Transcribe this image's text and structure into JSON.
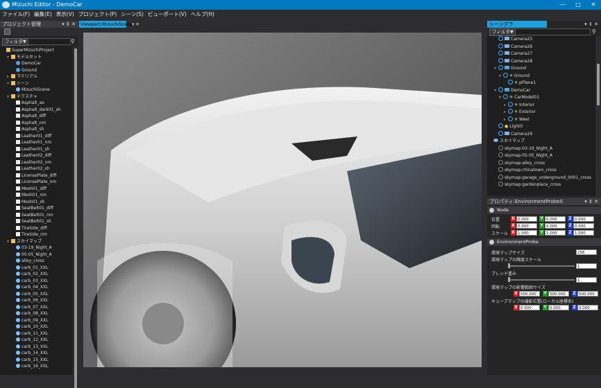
{
  "window": {
    "title": "Mizuchi Editor - DemoCar",
    "min": "—",
    "max": "□",
    "close": "✕"
  },
  "menu": [
    "ファイル(F)",
    "編集(E)",
    "表示(V)",
    "プロジェクト(P)",
    "シーン(S)",
    "ビューポート(V)",
    "ヘルプ(H)"
  ],
  "project": {
    "title": "プロジェクト管理",
    "pin": "▾ ⇕ ✕",
    "filter": "フィルタ▼",
    "search_icon": "⚲",
    "items": [
      {
        "label": "SuperMizuchiProject",
        "icon": "folder",
        "d": 0,
        "tw": ""
      },
      {
        "label": "モデルセット",
        "icon": "folder",
        "d": 1,
        "tw": "▿"
      },
      {
        "label": "DemoCar",
        "icon": "sphere",
        "d": 2,
        "tw": ""
      },
      {
        "label": "Ground",
        "icon": "sphere",
        "d": 2,
        "tw": ""
      },
      {
        "label": "マテリアル",
        "icon": "folder",
        "d": 1,
        "tw": "▹"
      },
      {
        "label": "シーン",
        "icon": "folder",
        "d": 1,
        "tw": "▿"
      },
      {
        "label": "MizuchiScene",
        "icon": "scene",
        "d": 2,
        "tw": ""
      },
      {
        "label": "テクスチャ",
        "icon": "folder",
        "d": 1,
        "tw": "▿"
      },
      {
        "label": "Asphalt_ao",
        "icon": "file",
        "d": 2,
        "tw": ""
      },
      {
        "label": "Asphalt_dark01_sh",
        "icon": "file",
        "d": 2,
        "tw": ""
      },
      {
        "label": "Asphalt_diff",
        "icon": "file",
        "d": 2,
        "tw": ""
      },
      {
        "label": "Asphalt_nm",
        "icon": "file",
        "d": 2,
        "tw": ""
      },
      {
        "label": "Asphalt_sh",
        "icon": "file",
        "d": 2,
        "tw": ""
      },
      {
        "label": "Leather01_diff",
        "icon": "file",
        "d": 2,
        "tw": ""
      },
      {
        "label": "Leather01_nm",
        "icon": "file",
        "d": 2,
        "tw": ""
      },
      {
        "label": "Leather01_sh",
        "icon": "file",
        "d": 2,
        "tw": ""
      },
      {
        "label": "Leather02_diff",
        "icon": "file",
        "d": 2,
        "tw": ""
      },
      {
        "label": "Leather02_nm",
        "icon": "file",
        "d": 2,
        "tw": ""
      },
      {
        "label": "Leather02_sh",
        "icon": "file",
        "d": 2,
        "tw": ""
      },
      {
        "label": "LicensePlate_diff",
        "icon": "file",
        "d": 2,
        "tw": ""
      },
      {
        "label": "LicensePlate_nm",
        "icon": "file",
        "d": 2,
        "tw": ""
      },
      {
        "label": "Mesh01_diff",
        "icon": "file",
        "d": 2,
        "tw": ""
      },
      {
        "label": "Mesh01_nm",
        "icon": "file",
        "d": 2,
        "tw": ""
      },
      {
        "label": "Mesh01_sh",
        "icon": "file",
        "d": 2,
        "tw": ""
      },
      {
        "label": "SeatBelt01_diff",
        "icon": "file",
        "d": 2,
        "tw": ""
      },
      {
        "label": "SeatBelt01_nm",
        "icon": "file",
        "d": 2,
        "tw": ""
      },
      {
        "label": "SeatBelt01_sh",
        "icon": "file",
        "d": 2,
        "tw": ""
      },
      {
        "label": "TireSide_diff",
        "icon": "file",
        "d": 2,
        "tw": ""
      },
      {
        "label": "TireSide_nm",
        "icon": "file",
        "d": 2,
        "tw": ""
      },
      {
        "label": "スカイマップ",
        "icon": "folder",
        "d": 1,
        "tw": "▿"
      },
      {
        "label": "03-19_Night_A",
        "icon": "scene",
        "d": 2,
        "tw": ""
      },
      {
        "label": "05-05_Night_A",
        "icon": "scene",
        "d": 2,
        "tw": ""
      },
      {
        "label": "alley_cross",
        "icon": "scene",
        "d": 2,
        "tw": ""
      },
      {
        "label": "carb_01_XXL",
        "icon": "scene",
        "d": 2,
        "tw": ""
      },
      {
        "label": "carb_02_XXL",
        "icon": "scene",
        "d": 2,
        "tw": ""
      },
      {
        "label": "carb_03_XXL",
        "icon": "scene",
        "d": 2,
        "tw": ""
      },
      {
        "label": "carb_04_XXL",
        "icon": "scene",
        "d": 2,
        "tw": ""
      },
      {
        "label": "carb_05_XXL",
        "icon": "scene",
        "d": 2,
        "tw": ""
      },
      {
        "label": "carb_06_XXL",
        "icon": "scene",
        "d": 2,
        "tw": ""
      },
      {
        "label": "carb_07_XXL",
        "icon": "scene",
        "d": 2,
        "tw": ""
      },
      {
        "label": "carb_08_XXL",
        "icon": "scene",
        "d": 2,
        "tw": ""
      },
      {
        "label": "carb_09_XXL",
        "icon": "scene",
        "d": 2,
        "tw": ""
      },
      {
        "label": "carb_10_XXL",
        "icon": "scene",
        "d": 2,
        "tw": ""
      },
      {
        "label": "carb_11_XXL",
        "icon": "scene",
        "d": 2,
        "tw": ""
      },
      {
        "label": "carb_12_XXL",
        "icon": "scene",
        "d": 2,
        "tw": ""
      },
      {
        "label": "carb_13_XXL",
        "icon": "scene",
        "d": 2,
        "tw": ""
      },
      {
        "label": "carb_14_XXL",
        "icon": "scene",
        "d": 2,
        "tw": ""
      },
      {
        "label": "carb_15_XXL",
        "icon": "scene",
        "d": 2,
        "tw": ""
      },
      {
        "label": "carb_16_XXL",
        "icon": "scene",
        "d": 2,
        "tw": ""
      }
    ]
  },
  "viewport": {
    "tab": "Viewport:MizuchiScene",
    "pin": "▾ ✕"
  },
  "scenegraph": {
    "title": "シーングラフ:MizuchiScene",
    "pin": "▾ ⇕ ✕",
    "filter": "フィルタ▼",
    "search_icon": "⚲",
    "rows": [
      {
        "label": "Camera25",
        "kind": "cam",
        "d": 1,
        "tw": ""
      },
      {
        "label": "Camera26",
        "kind": "cam",
        "d": 1,
        "tw": ""
      },
      {
        "label": "Camera27",
        "kind": "cam",
        "d": 1,
        "tw": ""
      },
      {
        "label": "Camera28",
        "kind": "cam",
        "d": 1,
        "tw": ""
      },
      {
        "label": "Ground",
        "kind": "model",
        "d": 1,
        "tw": "▿"
      },
      {
        "label": "Ground",
        "kind": "star",
        "d": 2,
        "tw": "▿"
      },
      {
        "label": "pPlane1",
        "kind": "star",
        "d": 3,
        "tw": ""
      },
      {
        "label": "DemoCar",
        "kind": "model",
        "d": 1,
        "tw": "▿"
      },
      {
        "label": "CarModel01",
        "kind": "star",
        "d": 2,
        "tw": "▿"
      },
      {
        "label": "Interior",
        "kind": "star",
        "d": 3,
        "tw": "▹"
      },
      {
        "label": "Exterior",
        "kind": "star",
        "d": 3,
        "tw": "▹"
      },
      {
        "label": "Weel",
        "kind": "star",
        "d": 3,
        "tw": "▹"
      },
      {
        "label": "Light0",
        "kind": "light",
        "d": 1,
        "tw": ""
      },
      {
        "label": "Camera29",
        "kind": "cam",
        "d": 1,
        "tw": ""
      },
      {
        "label": "スカイマップ",
        "kind": "sky",
        "d": 0,
        "tw": ""
      },
      {
        "label": "skymap:03-19_Night_A",
        "kind": "radio",
        "d": 1,
        "tw": ""
      },
      {
        "label": "skymap:05-05_Night_A",
        "kind": "radio",
        "d": 1,
        "tw": ""
      },
      {
        "label": "skymap:alley_cross",
        "kind": "radio",
        "d": 1,
        "tw": ""
      },
      {
        "label": "skymap:chinatown_cross",
        "kind": "radio",
        "d": 1,
        "tw": ""
      },
      {
        "label": "skymap:garage_underground_0001_cross",
        "kind": "radio",
        "d": 1,
        "tw": ""
      },
      {
        "label": "skymap:gardenplace_cross",
        "kind": "radio",
        "d": 1,
        "tw": ""
      }
    ]
  },
  "properties": {
    "title": "プロパティ:EnvironmentProbe0",
    "pin": "▾ ⇕ ✕",
    "node_section": "Node",
    "position_label": "位置",
    "rotation_label": "回転",
    "scale_label": "スケール",
    "axis_x": "X",
    "axis_y": "Y",
    "axis_z": "Z",
    "position": [
      "0.000",
      "0.000",
      "0.000"
    ],
    "rotation": [
      "0.000",
      "0.000",
      "0.000"
    ],
    "scale": [
      "1.000",
      "1.000",
      "1.000"
    ],
    "env_section": "EnvironmentProbe",
    "envmap_size_label": "環境マップサイズ",
    "envmap_size": "256",
    "mip_scale_label": "環境マップの輝度スケール",
    "mip_scale": "1",
    "blend_label": "ブレンド重み",
    "blend": "1",
    "range_label": "環境マップの影響範囲サイズ",
    "range": [
      "500.000",
      "500.000",
      "500.000"
    ],
    "cube_label": "キューブマップの撮影位置(ローカル座標系)",
    "cube": [
      "0.000",
      "0.000",
      "0.000"
    ]
  }
}
